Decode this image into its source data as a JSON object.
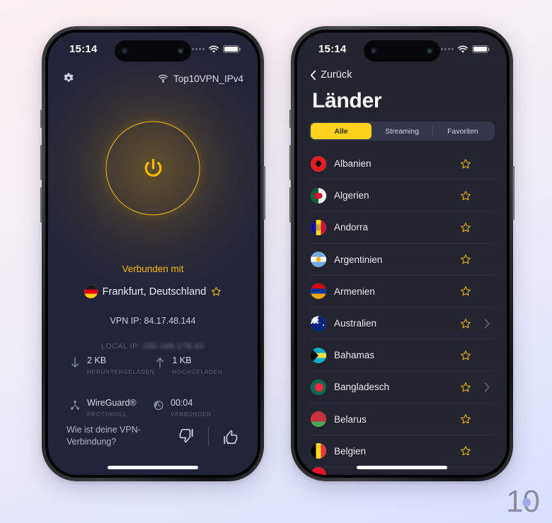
{
  "watermark": {
    "text": "10"
  },
  "left_phone": {
    "status_bar": {
      "time": "15:14"
    },
    "top_bar": {
      "settings_icon": "gear-icon",
      "wifi_icon": "wifi-lock-icon",
      "network_name": "Top10VPN_IPv4"
    },
    "power_button": {
      "icon": "power-icon",
      "state": "connected"
    },
    "connection": {
      "label": "Verbunden mit",
      "location": "Frankfurt, Deutschland",
      "flag": "de",
      "favorite_icon": "star-outline-icon",
      "vpn_ip": "VPN IP: 84.17.48.144",
      "local_ip_label": "LOCAL IP:",
      "local_ip_value": "192.168.178.44"
    },
    "stats": [
      {
        "icon": "arrow-down-icon",
        "value": "2 KB",
        "label": "HERUNTERGELADEN"
      },
      {
        "icon": "arrow-up-icon",
        "value": "1 KB",
        "label": "HOCHGELADEN"
      },
      {
        "icon": "protocol-icon",
        "value": "WireGuard®",
        "label": "PROTOKOLL"
      },
      {
        "icon": "clock-icon",
        "value": "00:04",
        "label": "VERBUNDEN"
      }
    ],
    "feedback": {
      "question": "Wie ist deine VPN-Verbindung?",
      "thumbs_down_icon": "thumbs-down-icon",
      "thumbs_up_icon": "thumbs-up-icon"
    }
  },
  "right_phone": {
    "status_bar": {
      "time": "15:14"
    },
    "back_label": "Zurück",
    "title": "Länder",
    "tabs": [
      {
        "label": "Alle",
        "active": true
      },
      {
        "label": "Streaming",
        "active": false
      },
      {
        "label": "Favoriten",
        "active": false
      }
    ],
    "countries": [
      {
        "name": "Albanien",
        "flag": "f-al",
        "favorite": false,
        "expandable": false
      },
      {
        "name": "Algerien",
        "flag": "f-dz",
        "favorite": false,
        "expandable": false
      },
      {
        "name": "Andorra",
        "flag": "f-ad",
        "favorite": false,
        "expandable": false
      },
      {
        "name": "Argentinien",
        "flag": "f-ar",
        "favorite": false,
        "expandable": false
      },
      {
        "name": "Armenien",
        "flag": "f-am",
        "favorite": false,
        "expandable": false
      },
      {
        "name": "Australien",
        "flag": "f-au",
        "favorite": false,
        "expandable": true
      },
      {
        "name": "Bahamas",
        "flag": "f-bs",
        "favorite": false,
        "expandable": false
      },
      {
        "name": "Bangladesch",
        "flag": "f-bd",
        "favorite": false,
        "expandable": true
      },
      {
        "name": "Belarus",
        "flag": "f-by",
        "favorite": false,
        "expandable": false
      },
      {
        "name": "Belgien",
        "flag": "f-be",
        "favorite": false,
        "expandable": false
      }
    ]
  },
  "colors": {
    "accent_yellow": "#ffd21e",
    "power_yellow": "#f5b800",
    "screen_bg_left": "#222438",
    "screen_bg_right": "#22242f",
    "page_bg_top": "#fbeff0",
    "page_bg_bottom": "#d9e0fb"
  }
}
